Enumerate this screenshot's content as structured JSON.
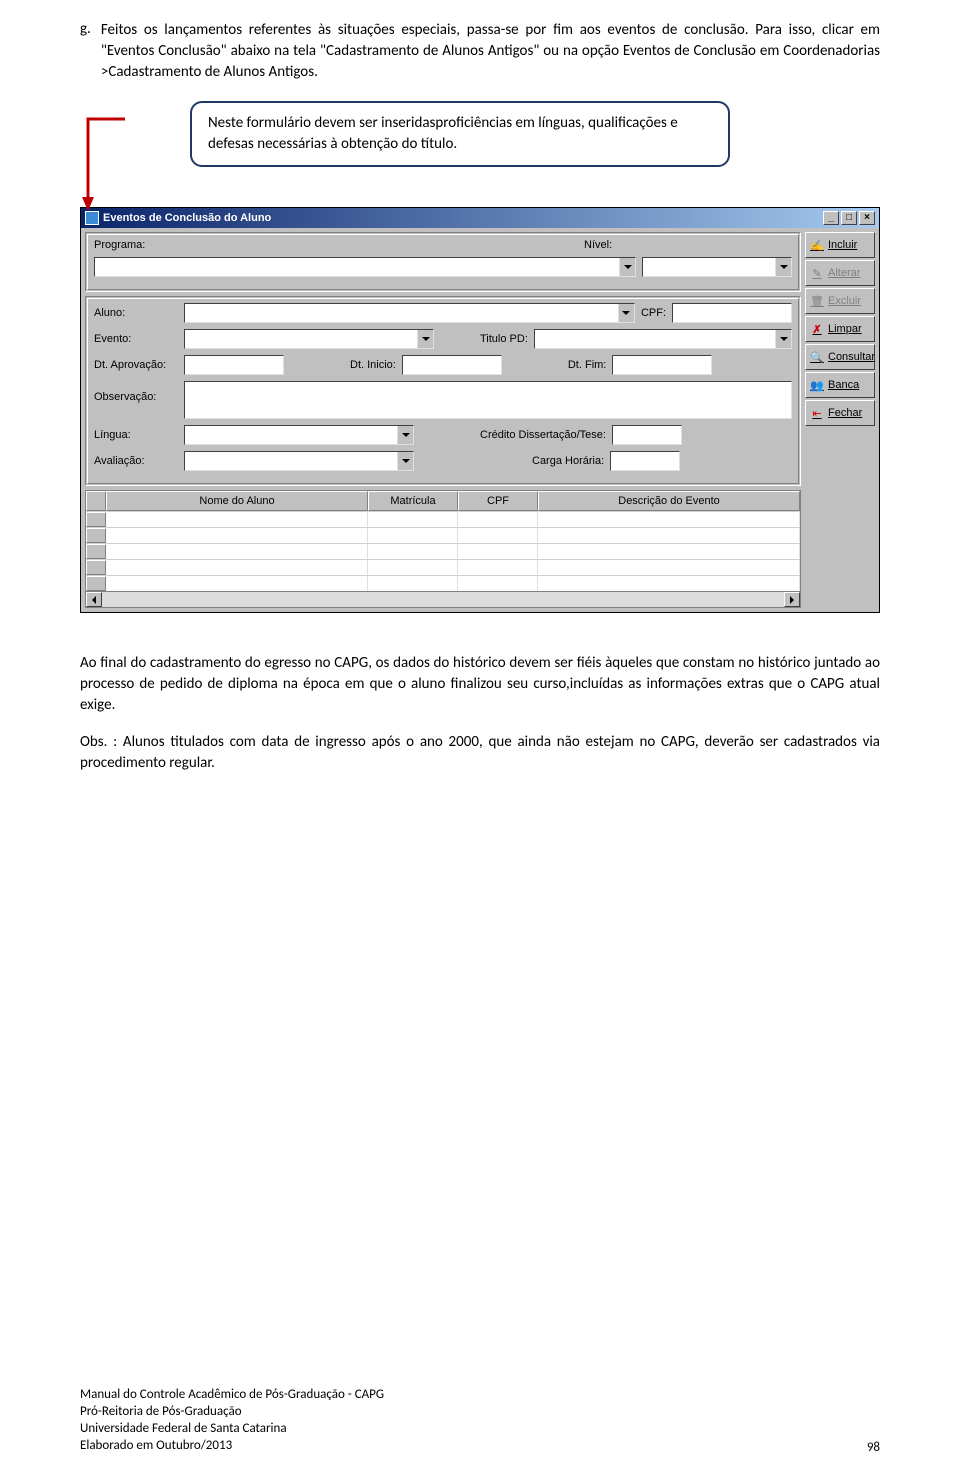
{
  "item_g": {
    "label": "g.",
    "text": "Feitos os lançamentos referentes às situações especiais, passa-se por fim aos eventos de conclusão. Para isso, clicar em \"Eventos Conclusão\" abaixo na tela \"Cadastramento de Alunos Antigos\" ou na opção Eventos de Conclusão em Coordenadorias >Cadastramento de Alunos Antigos."
  },
  "callout": "Neste formulário devem ser inseridasproficiências em línguas, qualificações e defesas necessárias à obtenção do título.",
  "app": {
    "title": "Eventos de Conclusão do Aluno",
    "labels": {
      "programa": "Programa:",
      "nivel": "Nível:",
      "aluno": "Aluno:",
      "cpf": "CPF:",
      "evento": "Evento:",
      "titulo_pd": "Titulo PD:",
      "dt_aprov": "Dt. Aprovação:",
      "dt_inicio": "Dt. Inicio:",
      "dt_fim": "Dt. Fim:",
      "observacao": "Observação:",
      "lingua": "Língua:",
      "credito": "Crédito Dissertação/Tese:",
      "avaliacao": "Avaliação:",
      "carga": "Carga Horária:"
    },
    "columns": {
      "nome": "Nome do Aluno",
      "matricula": "Matrícula",
      "cpf": "CPF",
      "descricao": "Descrição do Evento"
    },
    "buttons": {
      "incluir": "Incluir",
      "alterar": "Alterar",
      "excluir": "Excluir",
      "limpar": "Limpar",
      "consultar": "Consultar",
      "banca": "Banca",
      "fechar": "Fechar"
    }
  },
  "body_after": {
    "p1": "Ao final do cadastramento do egresso no CAPG, os dados do histórico devem ser fiéis àqueles que constam no histórico juntado ao processo de pedido de diploma na época em que o aluno finalizou seu curso,incluídas as informações extras que o CAPG atual exige.",
    "p2": "Obs. : Alunos titulados com data de ingresso após o ano 2000, que ainda não estejam no CAPG,  deverão ser cadastrados via procedimento regular."
  },
  "footer": {
    "l1": "Manual do Controle Acadêmico de Pós-Graduação - CAPG",
    "l2": "Pró-Reitoria de Pós-Graduação",
    "l3": "Universidade Federal de Santa Catarina",
    "l4": "Elaborado em Outubro/2013",
    "page": "98"
  }
}
